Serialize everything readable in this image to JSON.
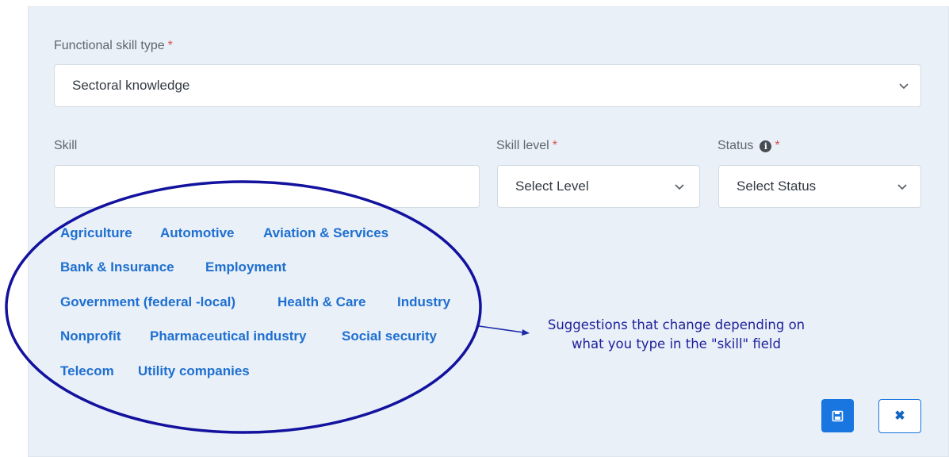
{
  "form": {
    "functional_skill_type": {
      "label": "Functional skill type",
      "required_mark": "*",
      "value": "Sectoral knowledge"
    },
    "skill": {
      "label": "Skill",
      "value": ""
    },
    "skill_level": {
      "label": "Skill level",
      "required_mark": "*",
      "value": "Select Level"
    },
    "status": {
      "label": "Status",
      "required_mark": "*",
      "value": "Select Status"
    }
  },
  "suggestions": [
    "Agriculture",
    "Automotive",
    "Aviation & Services",
    "Bank & Insurance",
    "Employment",
    "Government (federal -local)",
    "Health & Care",
    "Industry",
    "Nonprofit",
    "Pharmaceutical industry",
    "Social security",
    "Telecom",
    "Utility companies"
  ],
  "annotation": {
    "line1": "Suggestions that change depending on",
    "line2": "what you type in the \"skill\" field"
  },
  "actions": {
    "cancel_glyph": "✖"
  },
  "colors": {
    "panel": "#e9f0f8",
    "suggestion_link": "#1e6fd0",
    "annotation_ink": "#1c1f9a",
    "primary_button": "#1976e0",
    "required": "#d9534f"
  },
  "icons": [
    "chevron-down-icon",
    "info-icon",
    "save-icon",
    "close-icon"
  ]
}
